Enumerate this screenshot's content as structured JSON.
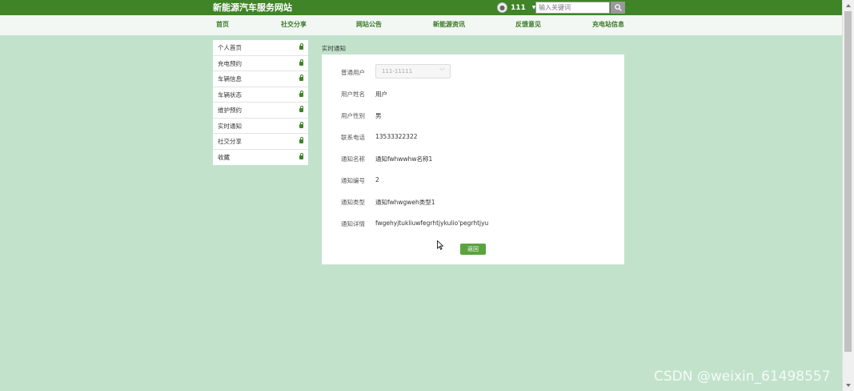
{
  "header": {
    "site_title": "新能源汽车服务网站",
    "username": "111",
    "search_placeholder": "输入关键词"
  },
  "nav": {
    "items": [
      "首页",
      "社交分享",
      "网站公告",
      "新能源资讯",
      "反馈意见",
      "充电站信息"
    ]
  },
  "sidebar": {
    "items": [
      "个人首页",
      "充电预约",
      "车辆信息",
      "车辆状态",
      "维护预约",
      "实时通知",
      "社交分享",
      "收藏"
    ]
  },
  "breadcrumb": "实时通知",
  "form": {
    "select_label": "普通用户",
    "select_value": "111-11111",
    "fields": [
      {
        "label": "用户姓名",
        "value": "用户"
      },
      {
        "label": "用户性别",
        "value": "男"
      },
      {
        "label": "联系电话",
        "value": "13533322322"
      },
      {
        "label": "通知名称",
        "value": "通知fwhwwhw名称1"
      },
      {
        "label": "通知编号",
        "value": "2"
      },
      {
        "label": "通知类型",
        "value": "通知fwhwgweh类型1"
      },
      {
        "label": "通知详情",
        "value": "fwgehyjtukliuwfegrhtjykulio'pegrhtjyu"
      }
    ],
    "back_label": "返回"
  },
  "watermark": "CSDN @weixin_61498557",
  "colors": {
    "header_bg": "#3f8427",
    "page_bg": "#c2e2cc",
    "button_bg": "#5aa43e",
    "nav_text": "#3a7a26"
  }
}
